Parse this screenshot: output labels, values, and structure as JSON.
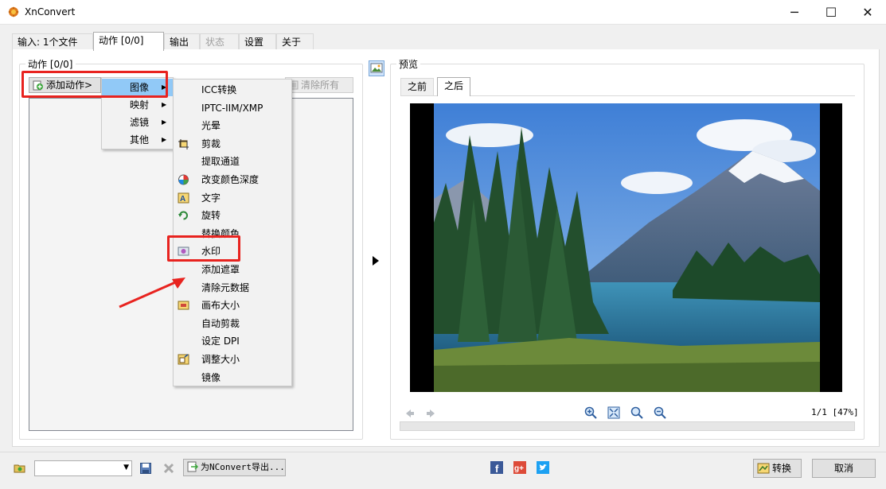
{
  "window": {
    "title": "XnConvert",
    "min": "─",
    "max": "☐",
    "close": "✕"
  },
  "tabs": [
    {
      "label": "输入: 1个文件"
    },
    {
      "label": "动作 [0/0]"
    },
    {
      "label": "输出"
    },
    {
      "label": "状态"
    },
    {
      "label": "设置"
    },
    {
      "label": "关于"
    }
  ],
  "actions_panel": {
    "title": "动作 [0/0]",
    "add_action": "添加动作>",
    "clear_all": "清除所有"
  },
  "add_action_menu": [
    "图像",
    "映射",
    "滤镜",
    "其他"
  ],
  "image_submenu": [
    {
      "label": "ICC转换",
      "icon": ""
    },
    {
      "label": "IPTC-IIM/XMP",
      "icon": ""
    },
    {
      "label": "光晕",
      "icon": ""
    },
    {
      "label": "剪裁",
      "icon": "crop-icon"
    },
    {
      "label": "提取通道",
      "icon": ""
    },
    {
      "label": "改变颜色深度",
      "icon": "color-depth-icon"
    },
    {
      "label": "文字",
      "icon": "text-icon"
    },
    {
      "label": "旋转",
      "icon": "rotate-icon"
    },
    {
      "label": "替换颜色",
      "icon": ""
    },
    {
      "label": "水印",
      "icon": "watermark-icon"
    },
    {
      "label": "添加遮罩",
      "icon": ""
    },
    {
      "label": "清除元数据",
      "icon": ""
    },
    {
      "label": "画布大小",
      "icon": "canvas-size-icon"
    },
    {
      "label": "自动剪裁",
      "icon": ""
    },
    {
      "label": "设定 DPI",
      "icon": ""
    },
    {
      "label": "调整大小",
      "icon": "resize-icon"
    },
    {
      "label": "镜像",
      "icon": ""
    }
  ],
  "preview": {
    "title": "预览",
    "tab_before": "之前",
    "tab_after": "之后",
    "zoom_info": "1/1 [47%]"
  },
  "bottom": {
    "export_label": "为NConvert导出...",
    "convert_label": "转换",
    "cancel_label": "取消"
  },
  "colors": {
    "highlight": "#91c9f7",
    "annotation_red": "#e8231f",
    "facebook": "#3b5998",
    "google_plus": "#dd4b39",
    "twitter": "#1da1f2"
  }
}
